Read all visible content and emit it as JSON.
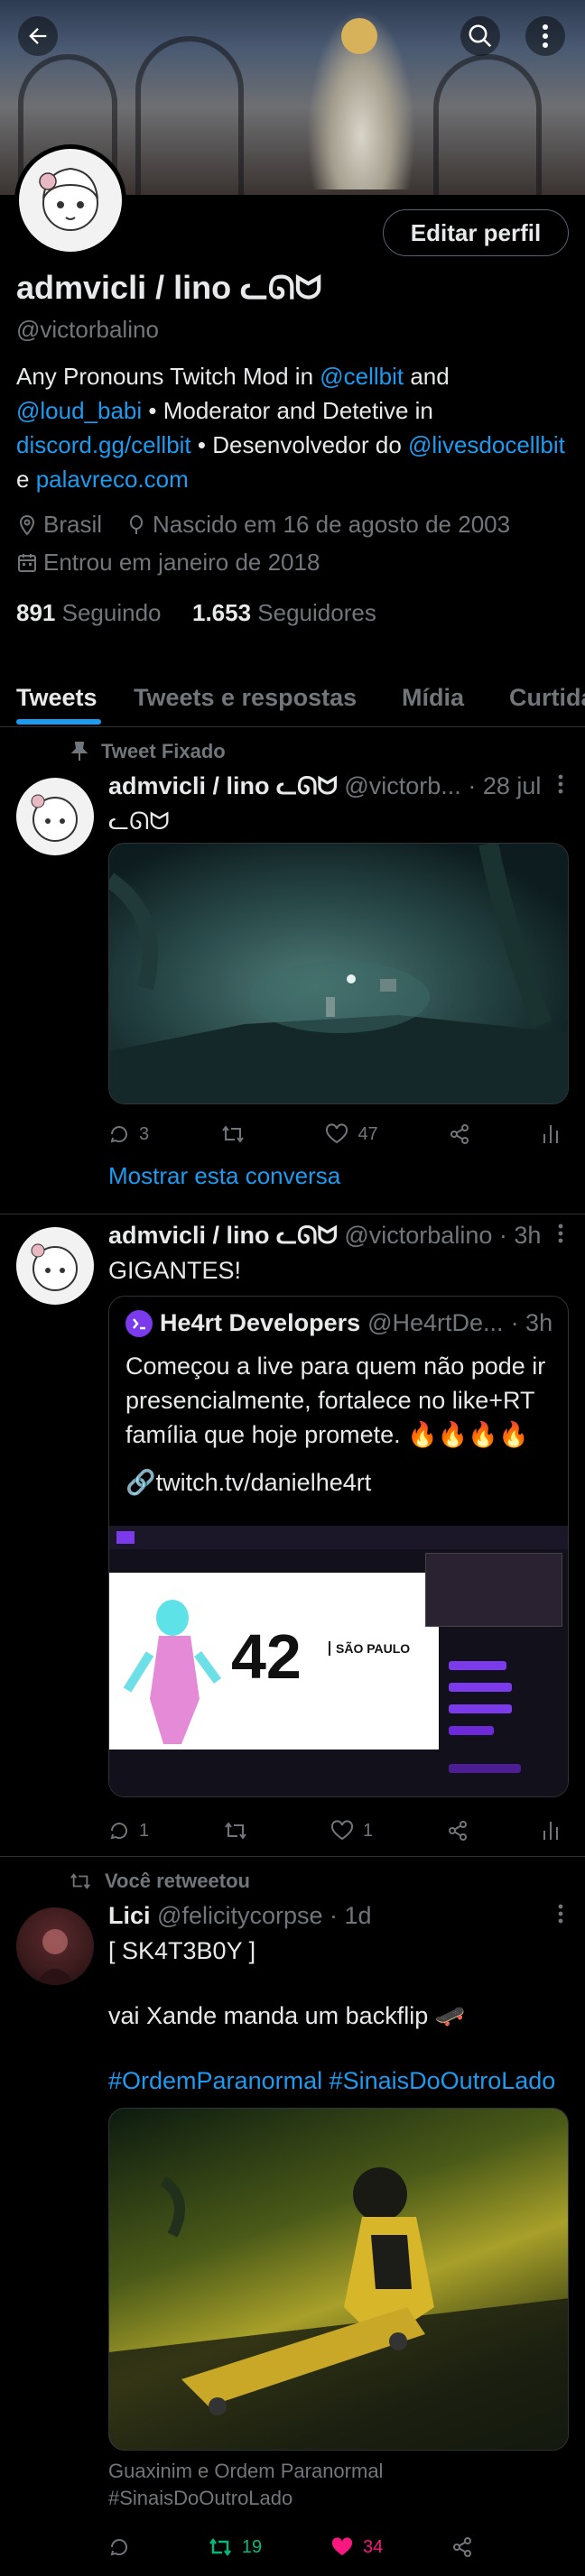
{
  "header": {
    "back_icon": "arrow-left-icon",
    "search_icon": "search-icon",
    "more_icon": "more-vertical-icon"
  },
  "profile": {
    "edit_label": "Editar perfil",
    "name": "admvicli / lino ᓚᘏᗢ",
    "handle": "@victorbalino",
    "bio": {
      "p1": "Any Pronouns  Twitch Mod in ",
      "link1": "@cellbit",
      "p2": " and ",
      "link2": "@loud_babi",
      "p3": "  • Moderator and Detetive in ",
      "link3": "discord.gg/cellbit",
      "p4": " • Desenvolvedor do ",
      "link4": "@livesdocellbit",
      "p5": " e ",
      "link5": "palavreco.com"
    },
    "location": "Brasil",
    "birthday": "Nascido em 16 de agosto de 2003",
    "joined": "Entrou em janeiro de 2018",
    "following_count": "891",
    "following_label": "Seguindo",
    "followers_count": "1.653",
    "followers_label": "Seguidores"
  },
  "tabs": [
    "Tweets",
    "Tweets e respostas",
    "Mídia",
    "Curtidas"
  ],
  "tweets": [
    {
      "context": "Tweet Fixado",
      "name": "admvicli / lino ᓚᘏᗢ",
      "handle": "@victorb...",
      "time": "· 28 jul",
      "text": "ᓚᘏᗢ",
      "replies": "3",
      "retweets": "",
      "likes": "47",
      "show_thread": "Mostrar esta conversa"
    },
    {
      "name": "admvicli / lino ᓚᘏᗢ",
      "handle": "@victorbalino",
      "time": "· 3h",
      "text": "GIGANTES!",
      "quote": {
        "name": "He4rt Developers",
        "handle": "@He4rtDe...",
        "time": "· 3h",
        "text": "Começou a live para quem não pode ir presencialmente, fortalece no like+RT família que hoje promete. 🔥🔥🔥🔥",
        "link": "🔗twitch.tv/danielhe4rt",
        "overlay_title": "42",
        "overlay_sub": "SÃO PAULO"
      },
      "replies": "1",
      "retweets": "",
      "likes": "1"
    },
    {
      "context": "Você retweetou",
      "name": "Lici",
      "handle": "@felicitycorpse",
      "time": "· 1d",
      "text1": "[ SK4T3B0Y ]",
      "text2": "vai Xande manda um backflip 🛹",
      "hashtag1": "#OrdemParanormal",
      "hashtag2": "#SinaisDoOutroLado",
      "caption1": "Guaxinim e Ordem Paranormal",
      "caption2": "#SinaisDoOutroLado",
      "replies": "",
      "retweets": "19",
      "likes": "34"
    }
  ],
  "colors": {
    "accent": "#1d9bf0",
    "retweet": "#00ba7c",
    "like": "#f91880",
    "muted": "#71767b"
  }
}
